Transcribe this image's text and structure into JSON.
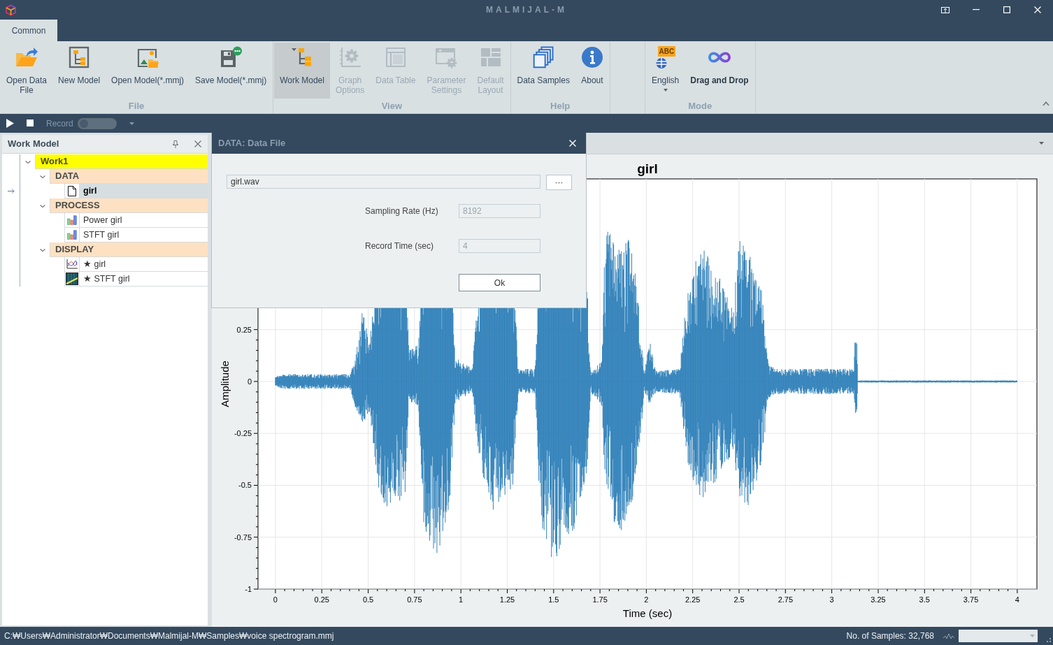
{
  "window": {
    "title": "MALMIJAL-M"
  },
  "ribbon": {
    "tabs": [
      {
        "label": "Common",
        "selected": true
      }
    ],
    "groups": [
      {
        "label": "File",
        "buttons": [
          {
            "kind": "open-data",
            "label_lines": [
              "Open Data",
              "File"
            ],
            "disabled": false,
            "selected": false,
            "active": false,
            "dropdown": false
          },
          {
            "kind": "new-model",
            "label_lines": [
              "New Model"
            ],
            "disabled": false,
            "selected": false,
            "active": false,
            "dropdown": false
          },
          {
            "kind": "open-model",
            "label_lines": [
              "Open Model(*.mmj)"
            ],
            "disabled": false,
            "selected": false,
            "active": false,
            "dropdown": false
          },
          {
            "kind": "save-model",
            "label_lines": [
              "Save Model(*.mmj)"
            ],
            "disabled": false,
            "selected": false,
            "active": false,
            "dropdown": false
          }
        ]
      },
      {
        "label": "View",
        "buttons": [
          {
            "kind": "work-model",
            "label_lines": [
              "Work Model"
            ],
            "disabled": false,
            "selected": true,
            "active": false,
            "dropdown": false
          },
          {
            "kind": "graph-options",
            "label_lines": [
              "Graph",
              "Options"
            ],
            "disabled": true,
            "selected": false,
            "active": false,
            "dropdown": false
          },
          {
            "kind": "data-table",
            "label_lines": [
              "Data Table"
            ],
            "disabled": true,
            "selected": false,
            "active": false,
            "dropdown": false
          },
          {
            "kind": "parameter-settings",
            "label_lines": [
              "Parameter",
              "Settings"
            ],
            "disabled": true,
            "selected": false,
            "active": false,
            "dropdown": false
          },
          {
            "kind": "default-layout",
            "label_lines": [
              "Default",
              "Layout"
            ],
            "disabled": true,
            "selected": false,
            "active": false,
            "dropdown": false
          }
        ]
      },
      {
        "label": "Help",
        "buttons": [
          {
            "kind": "data-samples",
            "label_lines": [
              "Data Samples"
            ],
            "disabled": false,
            "selected": false,
            "active": false,
            "dropdown": false
          },
          {
            "kind": "about",
            "label_lines": [
              "About"
            ],
            "disabled": false,
            "selected": false,
            "active": false,
            "dropdown": false
          }
        ]
      },
      {
        "label": "Mode",
        "buttons": [
          {
            "kind": "language",
            "badge": "ABC",
            "label_lines": [
              "English"
            ],
            "disabled": false,
            "selected": false,
            "active": false,
            "dropdown": true
          },
          {
            "kind": "drag-drop",
            "label_lines": [
              "Drag and Drop"
            ],
            "disabled": false,
            "selected": false,
            "active": true,
            "dropdown": false
          }
        ]
      }
    ]
  },
  "toolbar": {
    "record": {
      "label": "Record",
      "on": false
    }
  },
  "work_model_panel": {
    "title": "Work Model",
    "tree": [
      {
        "kind": "model",
        "label": "Work1",
        "expanded": true,
        "selected": false,
        "children": [
          {
            "kind": "category",
            "label": "DATA",
            "expanded": true,
            "selected": false,
            "children": [
              {
                "kind": "data",
                "label": "girl",
                "selected": true
              }
            ]
          },
          {
            "kind": "category",
            "label": "PROCESS",
            "expanded": true,
            "selected": false,
            "children": [
              {
                "kind": "process",
                "label": "Power girl",
                "selected": false
              },
              {
                "kind": "process",
                "label": "STFT girl",
                "selected": false
              }
            ]
          },
          {
            "kind": "category",
            "label": "DISPLAY",
            "expanded": true,
            "selected": false,
            "children": [
              {
                "kind": "graph",
                "label": "★ girl",
                "selected": false
              },
              {
                "kind": "spectrogram",
                "label": "★ STFT girl",
                "selected": false
              }
            ]
          }
        ]
      }
    ]
  },
  "document": {
    "chart_data": {
      "type": "line",
      "title": "girl",
      "xlabel": "Time (sec)",
      "ylabel": "Amplitude",
      "xlim": [
        -0.094,
        4.106
      ],
      "ylim": [
        -1,
        0.976
      ],
      "xticks": [
        0,
        0.25,
        0.5,
        0.75,
        1,
        1.25,
        1.5,
        1.75,
        2,
        2.25,
        2.5,
        2.75,
        3,
        3.25,
        3.5,
        3.75,
        4
      ],
      "yticks": [
        0.25,
        0,
        -0.25,
        -0.5,
        -0.75,
        -1
      ],
      "grid": true
    }
  },
  "dialog": {
    "title": "DATA: Data File",
    "file_field": {
      "value": "girl.wav"
    },
    "browse_button": {
      "label": "···"
    },
    "fields": [
      {
        "label": "Sampling Rate (Hz)",
        "value": "8192",
        "disabled": true
      },
      {
        "label": "Record Time (sec)",
        "value": "4",
        "disabled": true
      }
    ],
    "ok_button": {
      "label": "Ok"
    }
  },
  "status_bar": {
    "path": "C:₩Users₩Administrator₩Documents₩Malmijal-M₩Samples₩voice spectrogram.mmj",
    "sample_count": "No. of Samples: 32,768"
  }
}
